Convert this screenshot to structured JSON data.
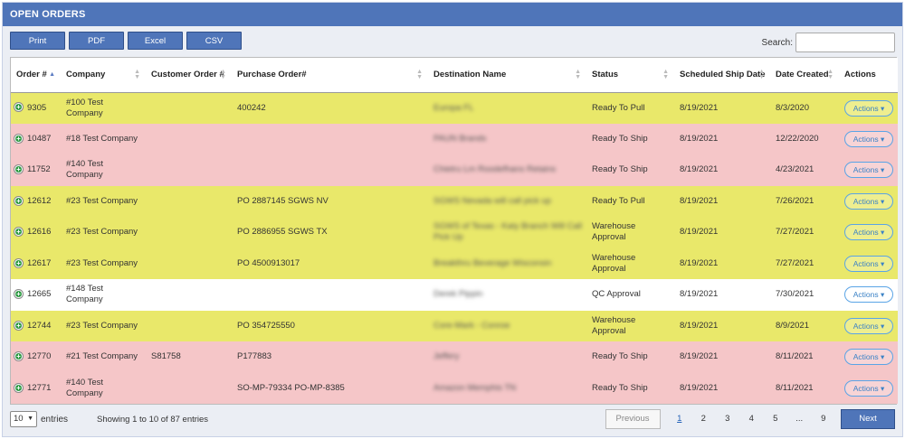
{
  "title": "OPEN ORDERS",
  "toolbar": {
    "print": "Print",
    "pdf": "PDF",
    "excel": "Excel",
    "csv": "CSV"
  },
  "search": {
    "label": "Search:",
    "value": ""
  },
  "columns": [
    "Order #",
    "Company",
    "Customer Order #",
    "Purchase Order#",
    "Destination Name",
    "Status",
    "Scheduled Ship Date",
    "Date Created",
    "Actions"
  ],
  "rows": [
    {
      "color": "yellow",
      "order": "9305",
      "company": "#100 Test Company",
      "customer_order": "",
      "po": "400242",
      "destination": "Europa FL",
      "status": "Ready To Pull",
      "ship": "8/19/2021",
      "created": "8/3/2020"
    },
    {
      "color": "pink",
      "order": "10487",
      "company": "#18 Test Company",
      "customer_order": "",
      "po": "",
      "destination": "PAUN Brands",
      "status": "Ready To Ship",
      "ship": "8/19/2021",
      "created": "12/22/2020"
    },
    {
      "color": "pink",
      "order": "11752",
      "company": "#140 Test Company",
      "customer_order": "",
      "po": "",
      "destination": "Chietru Lm Roodefhans Retains",
      "status": "Ready To Ship",
      "ship": "8/19/2021",
      "created": "4/23/2021"
    },
    {
      "color": "yellow",
      "order": "12612",
      "company": "#23 Test Company",
      "customer_order": "",
      "po": "PO 2887145 SGWS NV",
      "destination": "SGWS Nevada will call pick up",
      "status": "Ready To Pull",
      "ship": "8/19/2021",
      "created": "7/26/2021"
    },
    {
      "color": "yellow",
      "order": "12616",
      "company": "#23 Test Company",
      "customer_order": "",
      "po": "PO 2886955 SGWS TX",
      "destination": "SGWS of Texas - Katy Branch Will Call Pick Up",
      "status": "Warehouse Approval",
      "ship": "8/19/2021",
      "created": "7/27/2021"
    },
    {
      "color": "yellow",
      "order": "12617",
      "company": "#23 Test Company",
      "customer_order": "",
      "po": "PO 4500913017",
      "destination": "Breakthru Beverage Wisconsin",
      "status": "Warehouse Approval",
      "ship": "8/19/2021",
      "created": "7/27/2021"
    },
    {
      "color": "white",
      "order": "12665",
      "company": "#148 Test Company",
      "customer_order": "",
      "po": "",
      "destination": "Derek Pippin",
      "status": "QC Approval",
      "ship": "8/19/2021",
      "created": "7/30/2021"
    },
    {
      "color": "yellow",
      "order": "12744",
      "company": "#23 Test Company",
      "customer_order": "",
      "po": "PO 354725550",
      "destination": "Core-Mark - Conroe",
      "status": "Warehouse Approval",
      "ship": "8/19/2021",
      "created": "8/9/2021"
    },
    {
      "color": "pink",
      "order": "12770",
      "company": "#21 Test Company",
      "customer_order": "S81758",
      "po": "P177883",
      "destination": "Jeffery",
      "status": "Ready To Ship",
      "ship": "8/19/2021",
      "created": "8/11/2021"
    },
    {
      "color": "pink",
      "order": "12771",
      "company": "#140 Test Company",
      "customer_order": "",
      "po": "SO-MP-79334 PO-MP-8385",
      "destination": "Amazon Memphis TN",
      "status": "Ready To Ship",
      "ship": "8/19/2021",
      "created": "8/11/2021"
    }
  ],
  "actions_label": "Actions",
  "footer": {
    "length_value": "10",
    "length_suffix": "entries",
    "info": "Showing 1 to 10 of 87 entries",
    "previous": "Previous",
    "pages": [
      "1",
      "2",
      "3",
      "4",
      "5",
      "...",
      "9"
    ],
    "active_page": "1",
    "next": "Next"
  },
  "colors": {
    "header": "#4f75b9",
    "row_yellow": "#e9e86a",
    "row_pink": "#f5c6c8",
    "row_white": "#ffffff"
  }
}
